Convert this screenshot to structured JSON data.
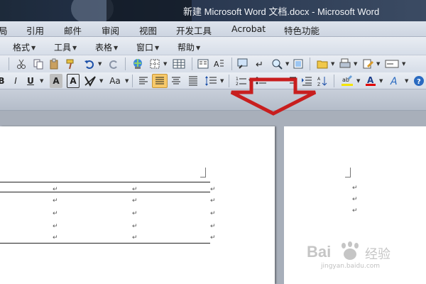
{
  "window": {
    "title": "新建 Microsoft Word 文档.docx - Microsoft Word"
  },
  "menubar": {
    "items": [
      "局",
      "引用",
      "邮件",
      "审阅",
      "视图",
      "开发工具",
      "Acrobat",
      "特色功能"
    ]
  },
  "classic_menu": {
    "items": [
      "格式",
      "工具",
      "表格",
      "窗口",
      "帮助"
    ]
  },
  "format_bar": {
    "bold_partial": "B",
    "italic_partial": "I",
    "underline": "U",
    "char_shading": "A",
    "char_border": "A",
    "change_case": "Aa"
  },
  "document": {
    "table_row_marks": [
      "↵",
      "↵",
      "↵",
      "↵",
      "↵",
      "↵",
      "↵",
      "↵",
      "↵",
      "↵",
      "↵",
      "↵",
      "↵",
      "↵",
      "↵"
    ],
    "page2_marks": [
      "↵",
      "↵",
      "↵"
    ]
  },
  "watermark": {
    "brand": "Bai",
    "brand_cn": "经验",
    "url": "jingyan.baidu.com"
  },
  "colors": {
    "accent_selected": "#f7c96a",
    "arrow": "#c81e1e"
  }
}
